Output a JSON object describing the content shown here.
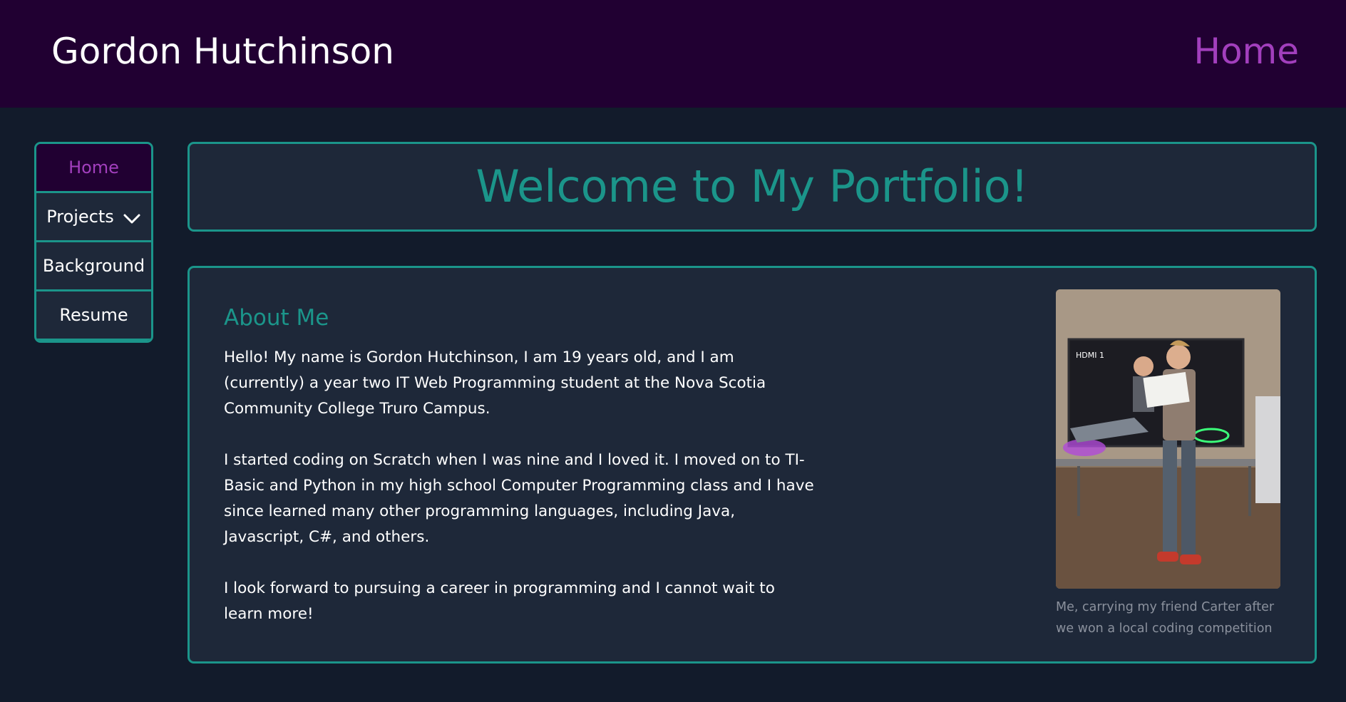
{
  "header": {
    "site_title": "Gordon Hutchinson",
    "current_page": "Home"
  },
  "side_nav": {
    "items": [
      {
        "label": "Home",
        "active": true
      },
      {
        "label": "Projects",
        "icon": "chevron-down-icon"
      },
      {
        "label": "Background"
      },
      {
        "label": "Resume"
      }
    ]
  },
  "welcome": {
    "title": "Welcome to My Portfolio!"
  },
  "about": {
    "heading": "About Me",
    "paragraphs": [
      "Hello! My name is Gordon Hutchinson, I am 19 years old, and I am (currently) a year two IT Web Programming student at the Nova Scotia Community College Truro Campus.",
      "I started coding on Scratch when I was nine and I loved it. I moved on to TI-Basic and Python in my high school Computer Programming class and I have since learned many other programming languages, including Java, Javascript, C#, and others.",
      "I look forward to pursuing a career in programming and I cannot wait to learn more!"
    ],
    "photo_caption": "Me, carrying my friend Carter after we won a local coding competition",
    "photo_screen_text": "HDMI 1"
  },
  "colors": {
    "header_bg": "#210032",
    "page_bg": "#121b2b",
    "card_bg": "#1e2839",
    "accent_teal": "#1b958a",
    "accent_purple": "#a23fbd",
    "caption_gray": "#8b919d"
  }
}
